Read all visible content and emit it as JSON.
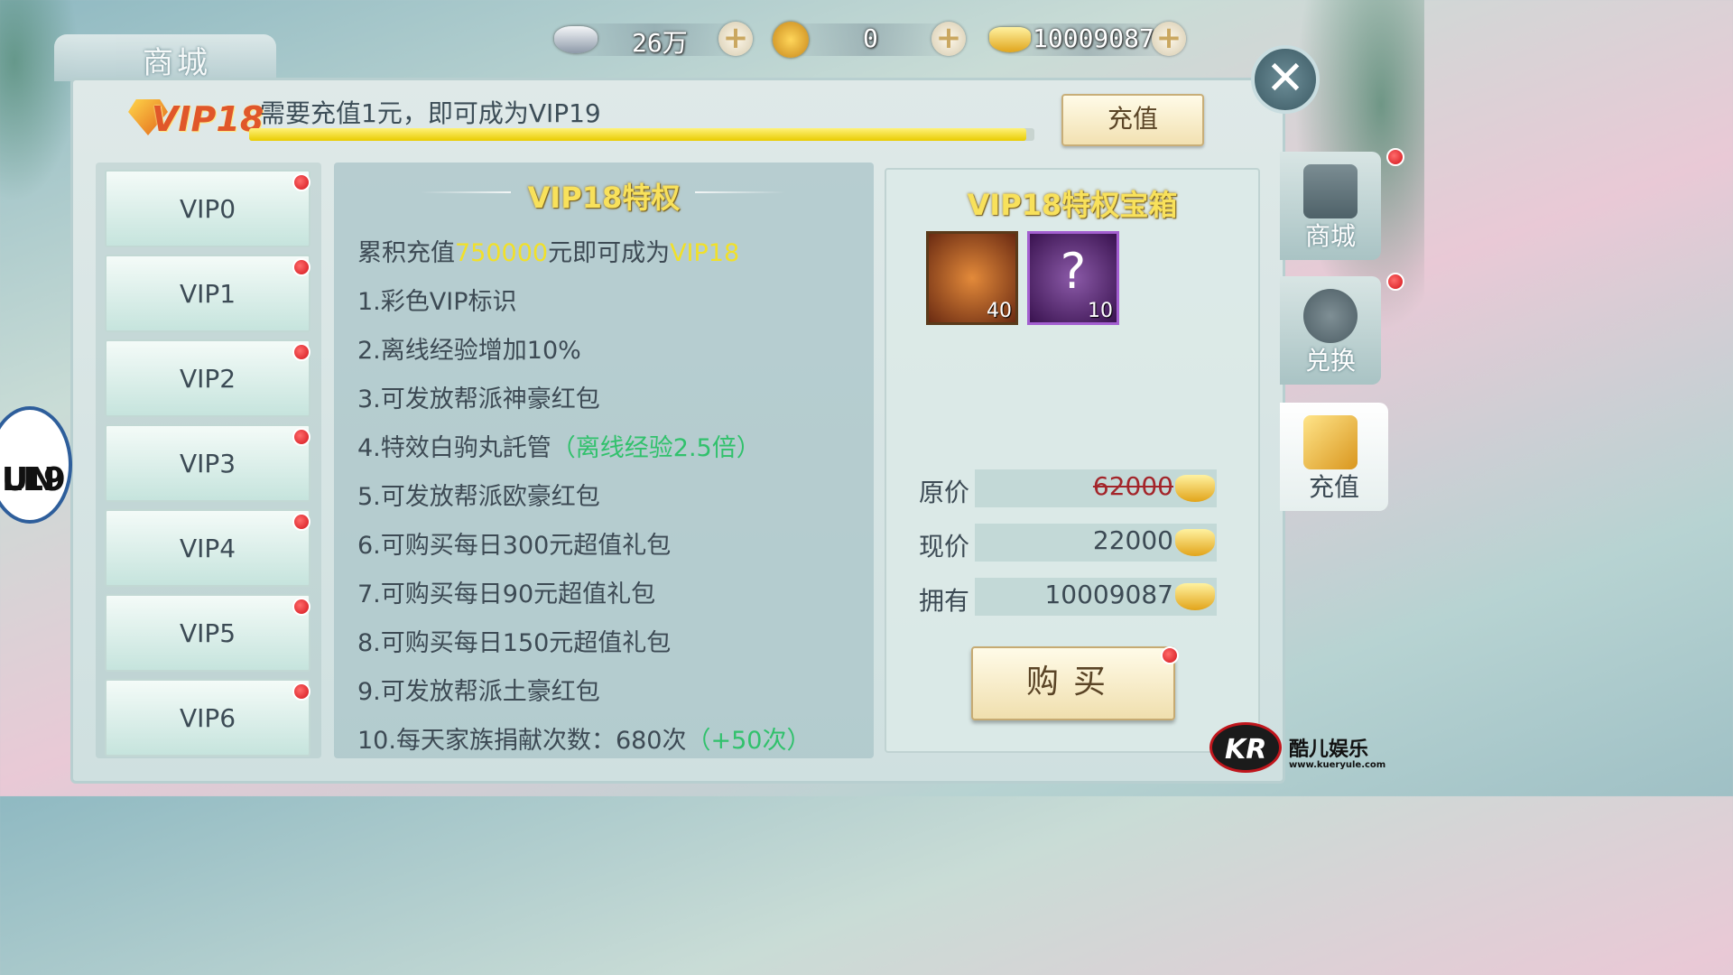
{
  "currency": {
    "silver": {
      "icon": "silver-ingot-icon",
      "value": "26万"
    },
    "copper": {
      "icon": "copper-coin-icon",
      "value": "0"
    },
    "gold": {
      "icon": "gold-ingot-icon",
      "value": "10009087"
    },
    "plus_label": "+"
  },
  "shop_tab": {
    "label": "商城"
  },
  "vip_bar": {
    "badge": "VIP18",
    "message": "需要充值1元，即可成为VIP19",
    "progress": 0.99,
    "recharge_label": "充值"
  },
  "vip_list": [
    "VIP0",
    "VIP1",
    "VIP2",
    "VIP3",
    "VIP4",
    "VIP5",
    "VIP6"
  ],
  "privileges": {
    "title": "VIP18特权",
    "intro_pre": "累积充值",
    "intro_amount": "750000",
    "intro_mid": "元即可成为",
    "intro_vip": "VIP18",
    "items": [
      {
        "text": "1.彩色VIP标识",
        "extra": ""
      },
      {
        "text": "2.离线经验增加10%",
        "extra": ""
      },
      {
        "text": "3.可发放帮派神豪红包",
        "extra": ""
      },
      {
        "text": "4.特效白驹丸託管",
        "extra": "（离线经验2.5倍）"
      },
      {
        "text": "5.可发放帮派欧豪红包",
        "extra": ""
      },
      {
        "text": "6.可购买每日300元超值礼包",
        "extra": ""
      },
      {
        "text": "7.可购买每日90元超值礼包",
        "extra": ""
      },
      {
        "text": "8.可购买每日150元超值礼包",
        "extra": ""
      },
      {
        "text": "9.可发放帮派土豪红包",
        "extra": ""
      },
      {
        "text": "10.每天家族捐献次数：680次",
        "extra": "（+50次）"
      }
    ]
  },
  "chest": {
    "title": "VIP18特权宝箱",
    "items": [
      {
        "icon": "scroll-icon",
        "count": "40"
      },
      {
        "icon": "mystery-orb-icon",
        "glyph": "?",
        "count": "10"
      }
    ],
    "original_label": "原价",
    "original_price": "62000",
    "current_label": "现价",
    "current_price": "22000",
    "owned_label": "拥有",
    "owned_amount": "10009087",
    "buy_label": "购买"
  },
  "side_tabs": [
    {
      "label": "商城",
      "icon": "shop-icon"
    },
    {
      "label": "兑换",
      "icon": "exchange-bag-icon"
    },
    {
      "label": "充值",
      "icon": "gift-box-icon"
    }
  ],
  "close_label": "✕",
  "left_logo": {
    "text_1": "LL9",
    "text_2": "UN"
  },
  "watermark": {
    "logo": "KR",
    "name": "酷儿娱乐",
    "url": "www.kueryule.com"
  }
}
